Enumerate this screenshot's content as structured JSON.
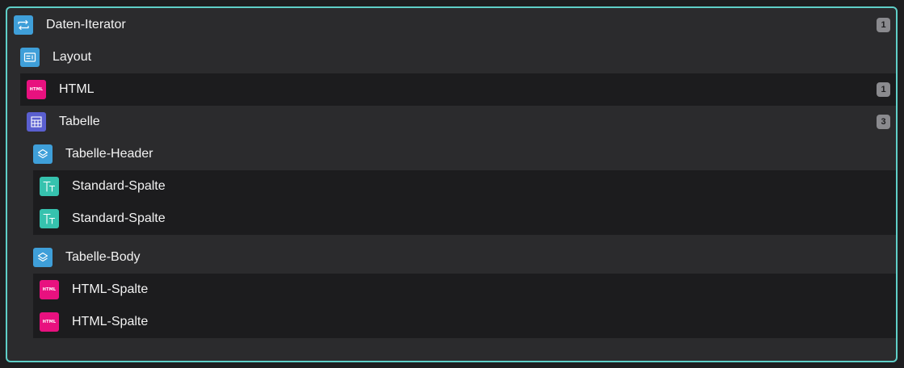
{
  "tree": {
    "iterator": {
      "label": "Daten-Iterator",
      "count": "1"
    },
    "layout": {
      "label": "Layout"
    },
    "html": {
      "label": "HTML",
      "count": "1",
      "icon_text": "HTML"
    },
    "table": {
      "label": "Tabelle",
      "count": "3"
    },
    "header": {
      "label": "Tabelle-Header",
      "columns": [
        {
          "label": "Standard-Spalte"
        },
        {
          "label": "Standard-Spalte"
        }
      ]
    },
    "body": {
      "label": "Tabelle-Body",
      "columns": [
        {
          "label": "HTML-Spalte",
          "icon_text": "HTML"
        },
        {
          "label": "HTML-Spalte",
          "icon_text": "HTML"
        }
      ]
    }
  },
  "colors": {
    "frame_border": "#5fcfc8",
    "iterator_icon": "#3f9fd9",
    "html_icon": "#e8117f",
    "table_icon": "#5a5fd0",
    "text_column_icon": "#36c2ae"
  },
  "icons": {
    "iterator": "loop-arrows-icon",
    "layout": "layout-card-icon",
    "html": "html-icon",
    "table": "table-grid-icon",
    "section": "layers-icon",
    "text_column": "text-type-icon"
  }
}
